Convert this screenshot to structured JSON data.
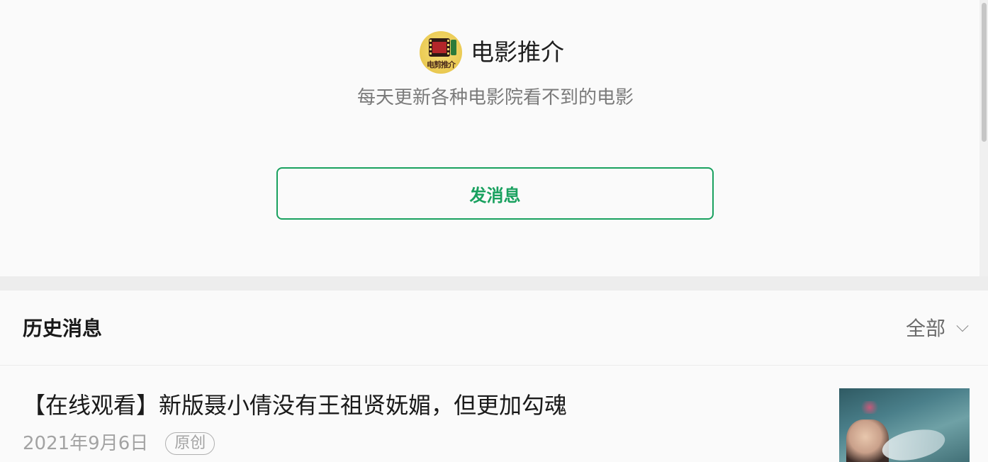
{
  "account": {
    "name": "电影推介",
    "description": "每天更新各种电影院看不到的电影",
    "avatar_caption": "电剪推介"
  },
  "actions": {
    "send_message_label": "发消息"
  },
  "history": {
    "title": "历史消息",
    "filter_label": "全部",
    "articles": [
      {
        "title": "【在线观看】新版聂小倩没有王祖贤妩媚，但更加勾魂",
        "date": "2021年9月6日",
        "badge": "原创"
      }
    ]
  },
  "colors": {
    "accent": "#19a15f",
    "background": "#fafafa",
    "divider": "#ededed"
  },
  "icons": {
    "filter": "chevron-down-icon"
  }
}
